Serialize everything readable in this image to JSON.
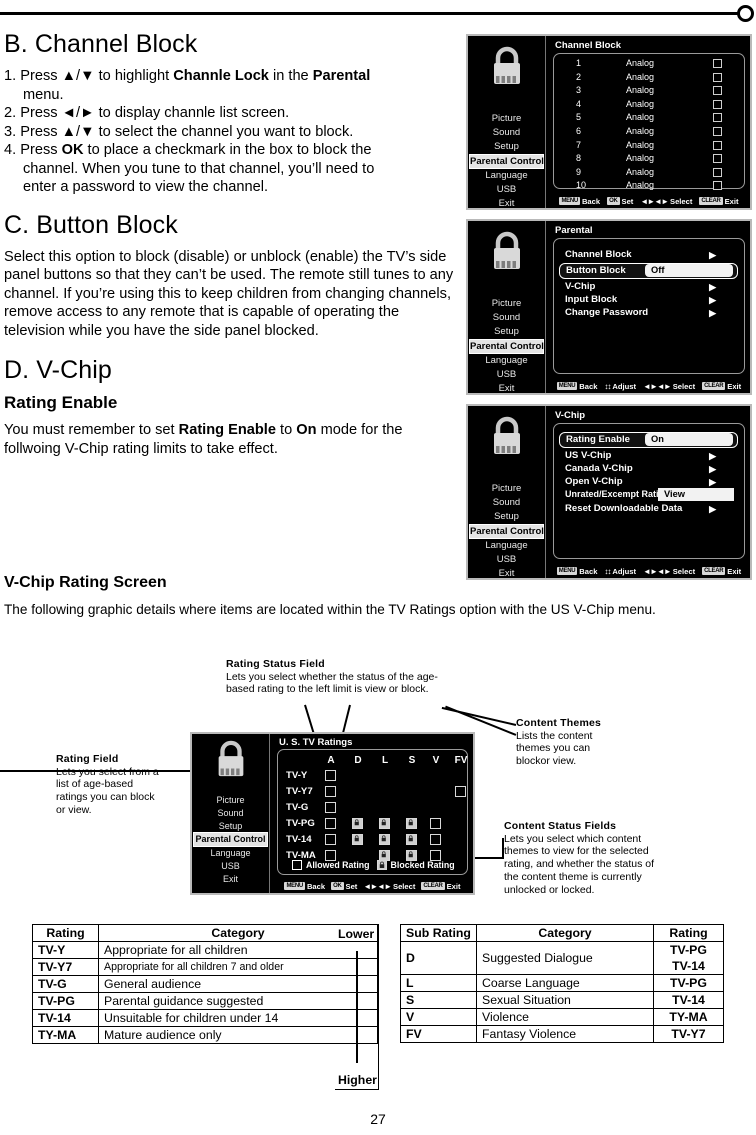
{
  "page": {
    "number": "27"
  },
  "sections": {
    "b": {
      "heading": "B. Channel Block",
      "steps": [
        {
          "num": "1.",
          "parts": [
            "Press ▲/▼ to highlight ",
            "Channle Lock",
            " in the ",
            "Parental",
            ""
          ],
          "cont": "menu."
        },
        {
          "num": "2.",
          "text": "Press ◄/► to display channle list screen."
        },
        {
          "num": "3.",
          "text": "Press ▲/▼ to select the channel you want to block."
        },
        {
          "num": "4.",
          "lead": "Press ",
          "bold": "OK",
          "rest": " to place a checkmark in the box to block the",
          "cont1": "channel. When you tune to that channel, you’ll need to",
          "cont2": "enter a password to view the channel."
        }
      ]
    },
    "c": {
      "heading": "C. Button Block",
      "body": "Select this option to block (disable) or unblock (enable) the TV’s side panel buttons so that they can’t be used. The remote still tunes to any channel. If you’re using this to keep children from changing channels, remove access to any remote that is capable of operating the television while you have the side panel blocked."
    },
    "d": {
      "heading": "D. V-Chip",
      "subheading": "Rating Enable",
      "body_lead": "You must remember to set ",
      "body_b1": "Rating Enable",
      "body_mid": " to ",
      "body_b2": "On",
      "body_rest": " mode for the follwoing V-Chip rating limits to take effect."
    },
    "vchip_screen": {
      "heading": "V-Chip Rating Screen",
      "body": "The following graphic details where items are located within the TV Ratings option with the US V-Chip menu."
    }
  },
  "tv_menus": {
    "common": {
      "icon": "padlock-icon",
      "sidebar_items": [
        "Picture",
        "Sound",
        "Setup",
        "Parental Control",
        "Language",
        "USB",
        "Exit"
      ],
      "selected_sidebar_item": "Parental Control"
    },
    "channel_block": {
      "title": "Channel Block",
      "rows": [
        {
          "number": "1",
          "type": "Analog",
          "checked": false
        },
        {
          "number": "2",
          "type": "Analog",
          "checked": false
        },
        {
          "number": "3",
          "type": "Analog",
          "checked": false
        },
        {
          "number": "4",
          "type": "Analog",
          "checked": false
        },
        {
          "number": "5",
          "type": "Analog",
          "checked": false
        },
        {
          "number": "6",
          "type": "Analog",
          "checked": false
        },
        {
          "number": "7",
          "type": "Analog",
          "checked": false
        },
        {
          "number": "8",
          "type": "Analog",
          "checked": false
        },
        {
          "number": "9",
          "type": "Analog",
          "checked": false
        },
        {
          "number": "10",
          "type": "Analog",
          "checked": false
        }
      ],
      "footer": [
        {
          "key": "MENU",
          "label": "Back"
        },
        {
          "key": "OK",
          "label": "Set"
        },
        {
          "key": "arrows",
          "label": "Select"
        },
        {
          "key": "CLEAR",
          "label": "Exit"
        }
      ]
    },
    "parental": {
      "title": "Parental",
      "rows": [
        {
          "label": "Channel Block",
          "kind": "submenu",
          "highlighted": false
        },
        {
          "label": "Button Block",
          "kind": "value",
          "value": "Off",
          "highlighted": true
        },
        {
          "label": "V-Chip",
          "kind": "submenu",
          "highlighted": false
        },
        {
          "label": "Input Block",
          "kind": "submenu",
          "highlighted": false
        },
        {
          "label": "Change Password",
          "kind": "submenu",
          "highlighted": false
        }
      ],
      "footer": [
        {
          "key": "MENU",
          "label": "Back"
        },
        {
          "key": "updown",
          "label": "Adjust"
        },
        {
          "key": "arrows",
          "label": "Select"
        },
        {
          "key": "CLEAR",
          "label": "Exit"
        }
      ]
    },
    "vchip": {
      "title": "V-Chip",
      "rows": [
        {
          "label": "Rating Enable",
          "kind": "value",
          "value": "On",
          "highlighted": true
        },
        {
          "label": "US V-Chip",
          "kind": "submenu",
          "highlighted": false
        },
        {
          "label": "Canada V-Chip",
          "kind": "submenu",
          "highlighted": false
        },
        {
          "label": "Open V-Chip",
          "kind": "submenu",
          "highlighted": false
        },
        {
          "label": "Unrated/Excempt Ratings",
          "kind": "value",
          "value": "View",
          "highlighted": false
        },
        {
          "label": "Reset Downloadable Data",
          "kind": "submenu",
          "highlighted": false
        }
      ],
      "footer": [
        {
          "key": "MENU",
          "label": "Back"
        },
        {
          "key": "updown",
          "label": "Adjust"
        },
        {
          "key": "arrows",
          "label": "Select"
        },
        {
          "key": "CLEAR",
          "label": "Exit"
        }
      ]
    },
    "us_tv_ratings": {
      "title": "U. S. TV Ratings",
      "columns": [
        "A",
        "D",
        "L",
        "S",
        "V",
        "FV"
      ],
      "rows": [
        {
          "label": "TV-Y",
          "cells": [
            "open",
            "",
            "",
            "",
            "",
            ""
          ]
        },
        {
          "label": "TV-Y7",
          "cells": [
            "open",
            "",
            "",
            "",
            "",
            "open"
          ]
        },
        {
          "label": "TV-G",
          "cells": [
            "open",
            "",
            "",
            "",
            "",
            ""
          ]
        },
        {
          "label": "TV-PG",
          "cells": [
            "open",
            "lock",
            "lock",
            "lock",
            "open",
            ""
          ]
        },
        {
          "label": "TV-14",
          "cells": [
            "open",
            "lock",
            "lock",
            "lock",
            "open",
            ""
          ]
        },
        {
          "label": "TV-MA",
          "cells": [
            "open",
            "",
            "lock",
            "lock",
            "open",
            ""
          ]
        }
      ],
      "legend": [
        {
          "kind": "open",
          "label": "Allowed Rating"
        },
        {
          "kind": "lock",
          "label": "Blocked Rating"
        }
      ],
      "footer": [
        {
          "key": "MENU",
          "label": "Back"
        },
        {
          "key": "OK",
          "label": "Set"
        },
        {
          "key": "arrows",
          "label": "Select"
        },
        {
          "key": "CLEAR",
          "label": "Exit"
        }
      ]
    }
  },
  "annotations": {
    "rating_status_field": {
      "title": "Rating Status Field",
      "body": "Lets you select whether the status of the age-based rating to the left  limit is view or block."
    },
    "rating_field": {
      "title": "Rating Field",
      "body": "Lets you select from a list of age-based ratings you can block or view."
    },
    "content_themes": {
      "title": "Content Themes",
      "body": "Lists the content themes you can blockor view."
    },
    "content_status_fields": {
      "title": "Content Status Fields",
      "body": "Lets you select which content themes to view for the selected rating, and whether the status of the content theme is currently unlocked or locked."
    }
  },
  "tables": {
    "ratings": {
      "headers": [
        "Rating",
        "Category",
        ""
      ],
      "scale": {
        "low": "Lower",
        "high": "Higher"
      },
      "rows": [
        {
          "rating": "TV-Y",
          "category": "Appropriate for all children"
        },
        {
          "rating": "TV-Y7",
          "category": "Appropriate for all children 7 and older"
        },
        {
          "rating": "TV-G",
          "category": "General audience"
        },
        {
          "rating": "TV-PG",
          "category": "Parental guidance suggested"
        },
        {
          "rating": "TV-14",
          "category": "Unsuitable for children under 14"
        },
        {
          "rating": "TY-MA",
          "category": "Mature audience only"
        }
      ]
    },
    "sub_ratings": {
      "headers": [
        "Sub Rating",
        "Category",
        "Rating"
      ],
      "rows": [
        {
          "sub": "D",
          "category": "Suggested Dialogue",
          "ratings": [
            "TV-PG",
            "TV-14"
          ]
        },
        {
          "sub": "L",
          "category": "Coarse Language",
          "ratings": [
            "TV-PG"
          ]
        },
        {
          "sub": "S",
          "category": "Sexual Situation",
          "ratings": [
            "TV-14"
          ]
        },
        {
          "sub": "V",
          "category": "Violence",
          "ratings": [
            "TY-MA"
          ]
        },
        {
          "sub": "FV",
          "category": "Fantasy Violence",
          "ratings": [
            "TV-Y7"
          ]
        }
      ]
    }
  },
  "colors": {
    "menu_bg": "#000000",
    "menu_border": "#b9b9b9",
    "highlight": "#f2f2f2",
    "text": "#ffffff"
  }
}
